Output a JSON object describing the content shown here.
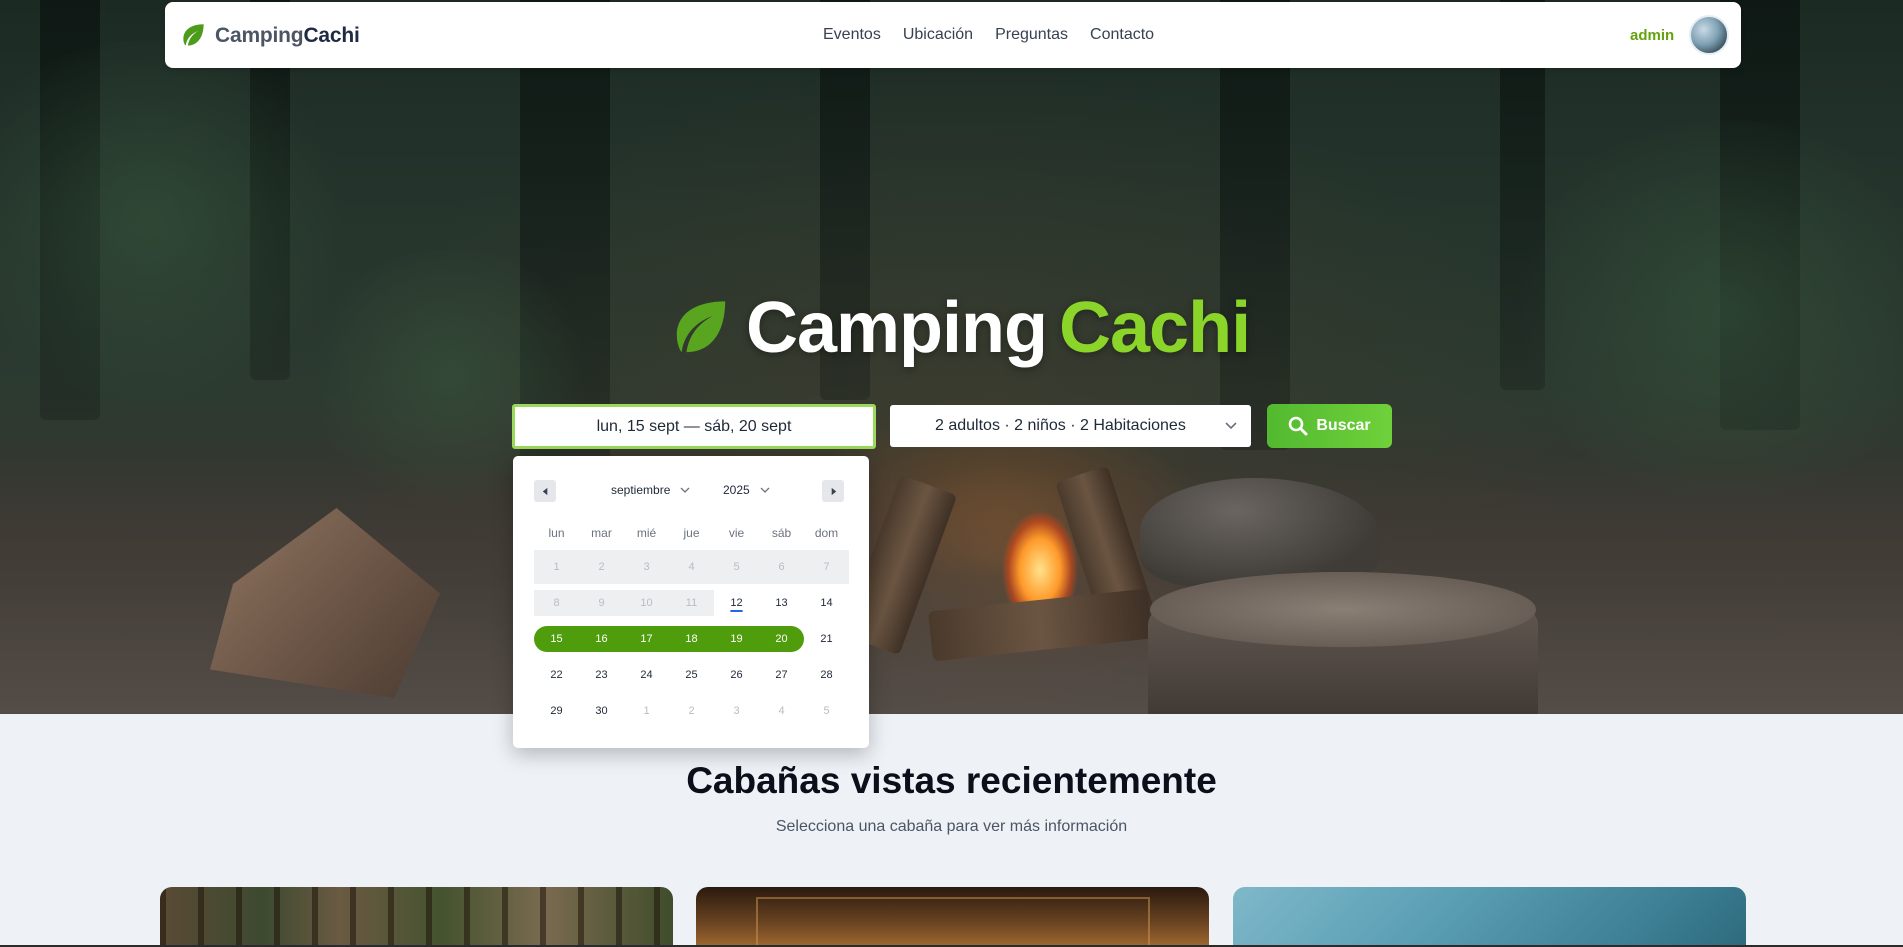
{
  "brand": {
    "part1": "Camping",
    "part2": "Cachi"
  },
  "nav": {
    "links": [
      "Eventos",
      "Ubicación",
      "Preguntas",
      "Contacto"
    ]
  },
  "user": {
    "name": "admin"
  },
  "hero": {
    "title_part1": "Camping",
    "title_part2": "Cachi"
  },
  "search": {
    "date_range": "lun, 15 sept — sáb, 20 sept",
    "guests": "2 adultos · 2 niños · 2 Habitaciones",
    "button_label": "Buscar"
  },
  "calendar": {
    "month": "septiembre",
    "year": "2025",
    "weekdays": [
      "lun",
      "mar",
      "mié",
      "jue",
      "vie",
      "sáb",
      "dom"
    ],
    "weeks": [
      [
        "1",
        "2",
        "3",
        "4",
        "5",
        "6",
        "7"
      ],
      [
        "8",
        "9",
        "10",
        "11",
        "12",
        "13",
        "14"
      ],
      [
        "15",
        "16",
        "17",
        "18",
        "19",
        "20",
        "21"
      ],
      [
        "22",
        "23",
        "24",
        "25",
        "26",
        "27",
        "28"
      ],
      [
        "29",
        "30",
        "1",
        "2",
        "3",
        "4",
        "5"
      ]
    ],
    "today": "12",
    "selected_start": "15",
    "selected_end": "20"
  },
  "section": {
    "title": "Cabañas vistas recientemente",
    "subtitle": "Selecciona una cabaña para ver más información"
  },
  "colors": {
    "accent": "#8bd42a",
    "selected": "#4f9d0c",
    "button": "#52b930"
  }
}
